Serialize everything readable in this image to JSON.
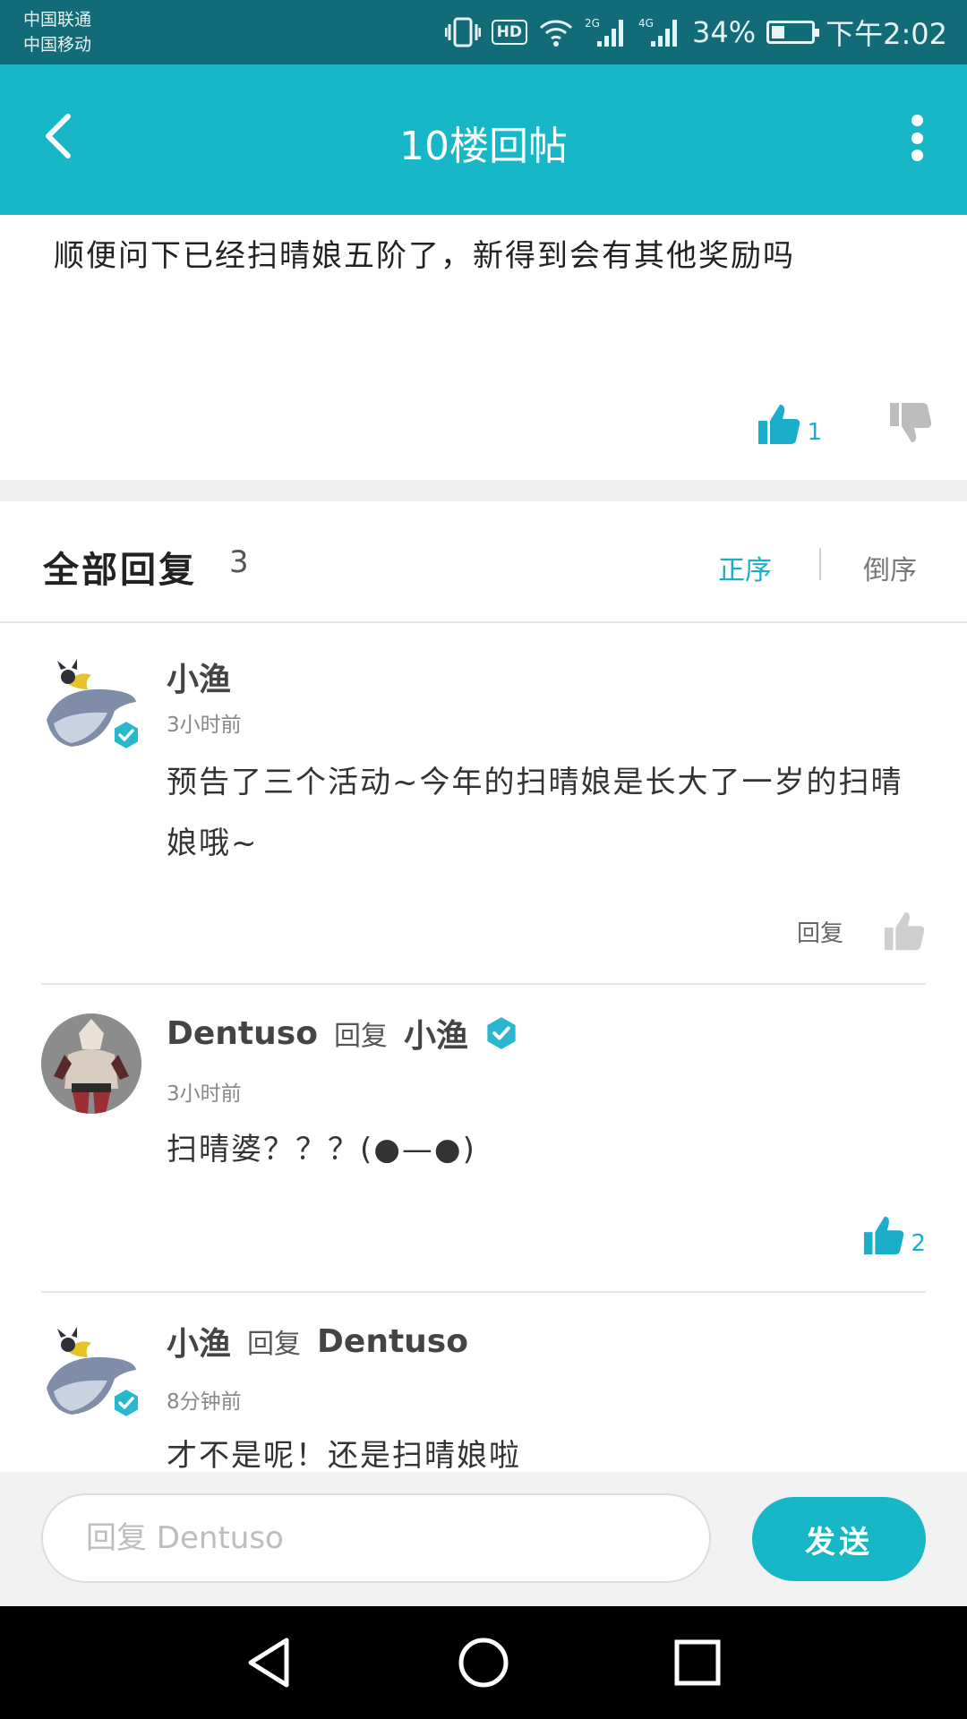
{
  "status_bar": {
    "carrier_1": "中国联通",
    "carrier_2": "中国移动",
    "network_2g": "2G",
    "network_4g": "4G",
    "battery": "34%",
    "battery_level": 0.34,
    "time": "下午2:02"
  },
  "header": {
    "title": "10楼回帖"
  },
  "post": {
    "text": "顺便问下已经扫晴娘五阶了，新得到会有其他奖励吗",
    "like_count": "1"
  },
  "replies_header": {
    "title": "全部回复",
    "count": "3",
    "sort_asc": "正序",
    "sort_desc": "倒序"
  },
  "replies": [
    {
      "author": "小渔",
      "verified": true,
      "time": "3小时前",
      "content": "预告了三个活动~今年的扫晴娘是长大了一岁的扫晴娘哦~",
      "reply_action": "回复"
    },
    {
      "author": "Dentuso",
      "reply_word": "回复",
      "reply_to": "小渔",
      "time": "3小时前",
      "content": "扫晴婆？？？(●—●)",
      "like_count": "2"
    },
    {
      "author": "小渔",
      "verified": true,
      "reply_word": "回复",
      "reply_to": "Dentuso",
      "time": "8分钟前",
      "content": "才不是呢！还是扫晴娘啦"
    }
  ],
  "composer": {
    "placeholder": "回复 Dentuso",
    "send_label": "发送"
  },
  "colors": {
    "accent": "#17b7c8",
    "status_bar": "#116c78",
    "like_blue": "#1aaeca"
  }
}
